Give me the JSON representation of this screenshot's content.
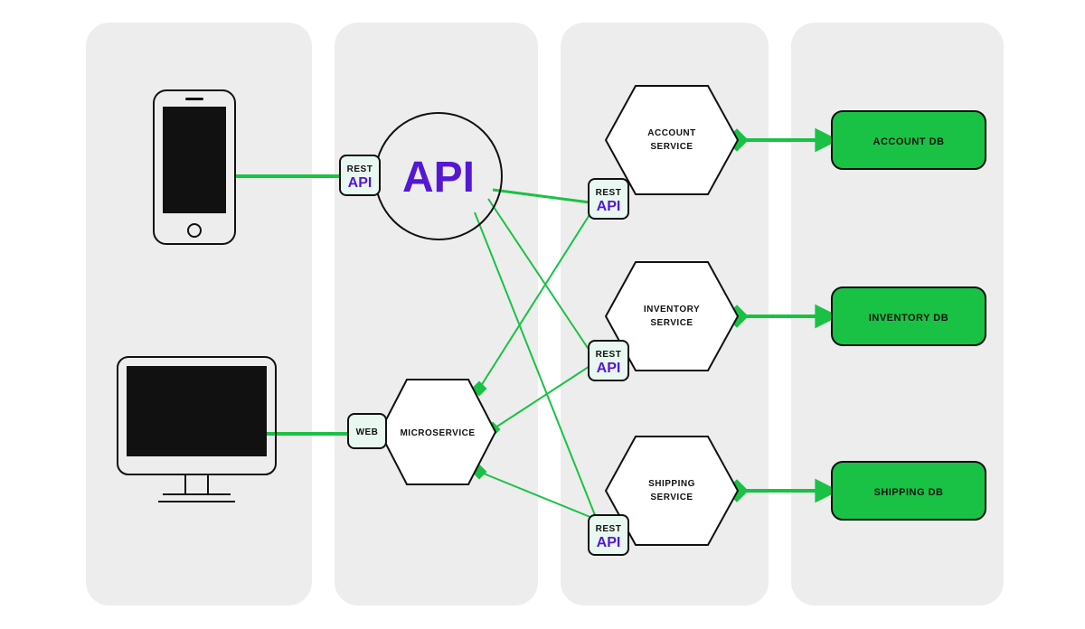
{
  "clients": {
    "mobile": {
      "connector_label_line1": "REST",
      "connector_label_line2": "API"
    },
    "desktop": {
      "connector_label": "WEB"
    }
  },
  "gateway": {
    "api_circle_label": "API",
    "microservice_hex_label": "MICROSERVICE"
  },
  "services": [
    {
      "name_line1": "ACCOUNT",
      "name_line2": "SERVICE",
      "rest_line1": "REST",
      "rest_line2": "API",
      "db_label": "ACCOUNT DB"
    },
    {
      "name_line1": "INVENTORY",
      "name_line2": "SERVICE",
      "rest_line1": "REST",
      "rest_line2": "API",
      "db_label": "INVENTORY DB"
    },
    {
      "name_line1": "SHIPPING",
      "name_line2": "SERVICE",
      "rest_line1": "REST",
      "rest_line2": "API",
      "db_label": "SHIPPING DB"
    }
  ],
  "colors": {
    "green": "#19c244",
    "purple": "#5418d3",
    "panel": "#ededed"
  }
}
